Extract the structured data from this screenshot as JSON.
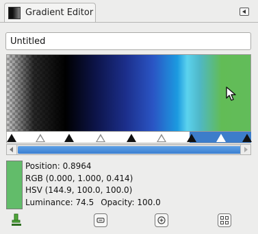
{
  "tab": {
    "title": "Gradient Editor"
  },
  "name_field": {
    "value": "Untitled"
  },
  "info": {
    "position": "Position: 0.8964",
    "rgb": "RGB (0.000, 1.000, 0.414)",
    "hsv": "HSV (144.9, 100.0, 100.0)",
    "luminance": "Luminance: 74.5",
    "opacity": "Opacity: 100.0"
  },
  "colors": {
    "selection": "#3d7dca",
    "current_color": "#62bc6a"
  },
  "icons": {
    "tab": "gradient-icon",
    "menu": "tab-menu-icon",
    "cursor": "mouse-pointer-icon",
    "buttons": [
      "color-picker-icon",
      "zoom-out-icon",
      "zoom-in-icon",
      "zoom-all-icon"
    ]
  }
}
